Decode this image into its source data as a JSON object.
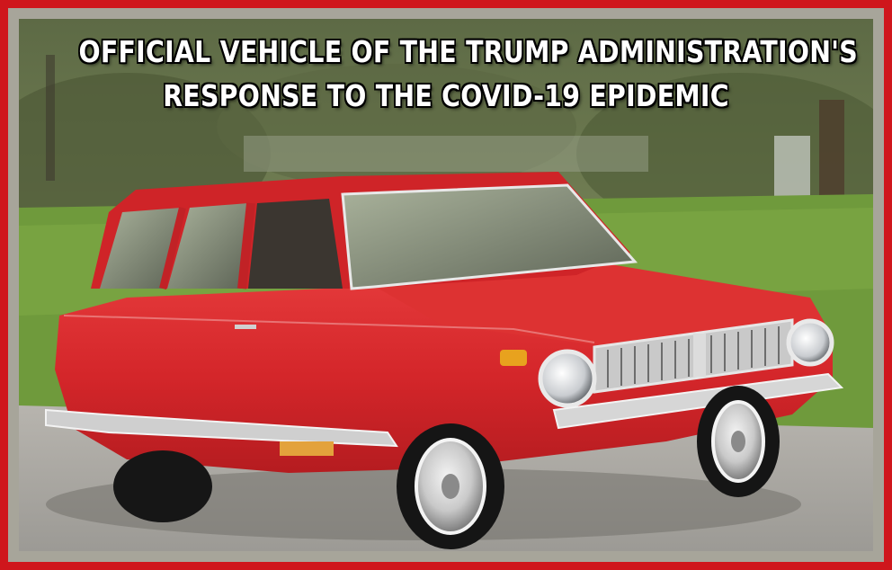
{
  "caption": {
    "line1": "OFFICIAL VEHICLE OF THE TRUMP ADMINISTRATION'S",
    "line2": "RESPONSE TO THE COVID-19 EPIDEMIC"
  },
  "colors": {
    "frame": "#cf161c",
    "car_body": "#d9262a",
    "lawn": "#6f9a3c",
    "road": "#a9a7a2"
  }
}
